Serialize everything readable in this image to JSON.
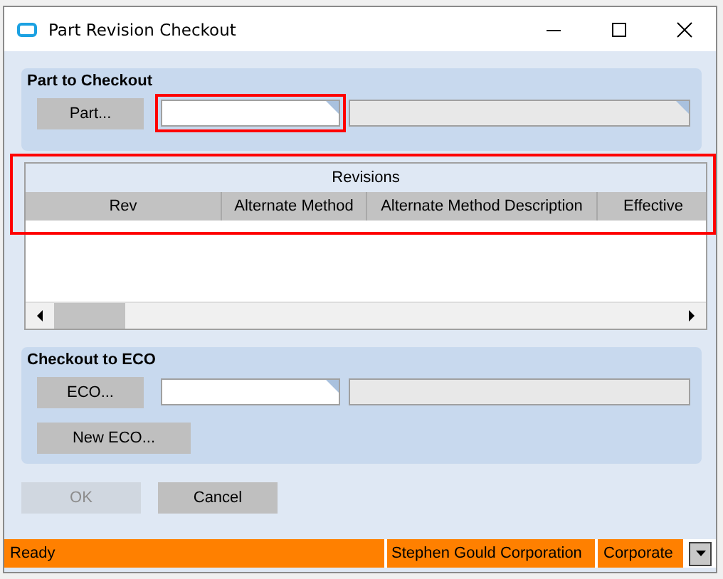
{
  "window": {
    "title": "Part Revision Checkout"
  },
  "part_group": {
    "title": "Part to Checkout",
    "button": "Part...",
    "field": {
      "highlighted": true
    }
  },
  "revisions": {
    "title": "Revisions",
    "highlighted": true,
    "columns": [
      "Rev",
      "Alternate Method",
      "Alternate Method Description",
      "Effective"
    ]
  },
  "eco_group": {
    "title": "Checkout to ECO",
    "button": "ECO...",
    "new_button": "New ECO..."
  },
  "buttons": [
    {
      "label": "OK",
      "disabled": true
    },
    {
      "label": "Cancel",
      "disabled": false
    }
  ],
  "status_bar": [
    "Ready",
    "Stephen Gould Corporation",
    "Corporate"
  ]
}
